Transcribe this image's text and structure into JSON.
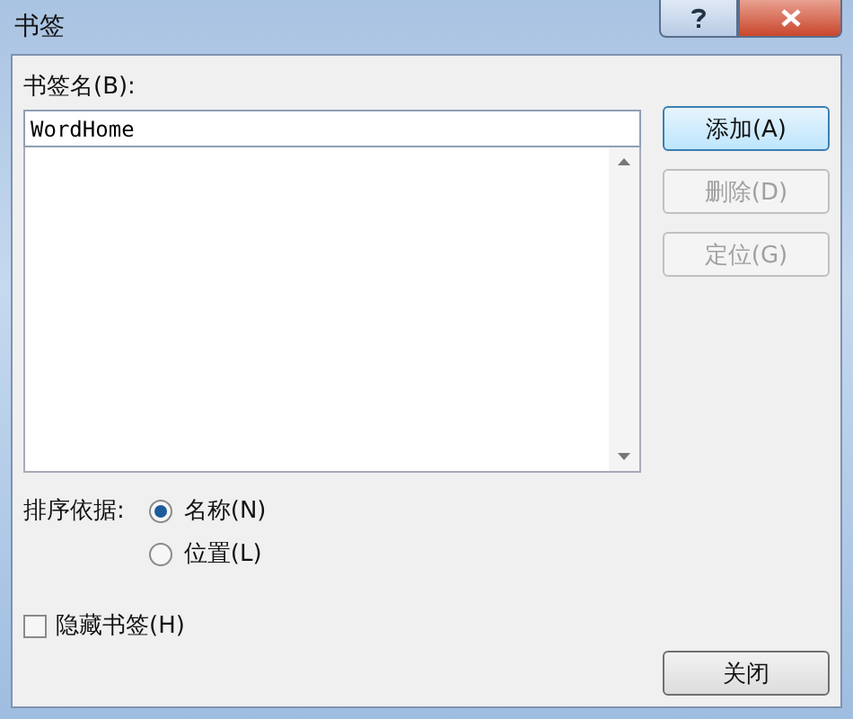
{
  "window": {
    "title": "书签"
  },
  "name_label": "书签名(B):",
  "name_field": {
    "value": "WordHome"
  },
  "buttons": [
    {
      "label": "添加(A)",
      "disabled": false,
      "hovered": true
    },
    {
      "label": "删除(D)",
      "disabled": true,
      "hovered": false
    },
    {
      "label": "定位(G)",
      "disabled": true,
      "hovered": false
    }
  ],
  "sort_label": "排序依据:",
  "sort_options": [
    {
      "label": "名称(N)",
      "selected": true
    },
    {
      "label": "位置(L)",
      "selected": false
    }
  ],
  "hide_bookmarks": {
    "label": "隐藏书签(H)",
    "checked": false
  },
  "close_button": "关闭"
}
